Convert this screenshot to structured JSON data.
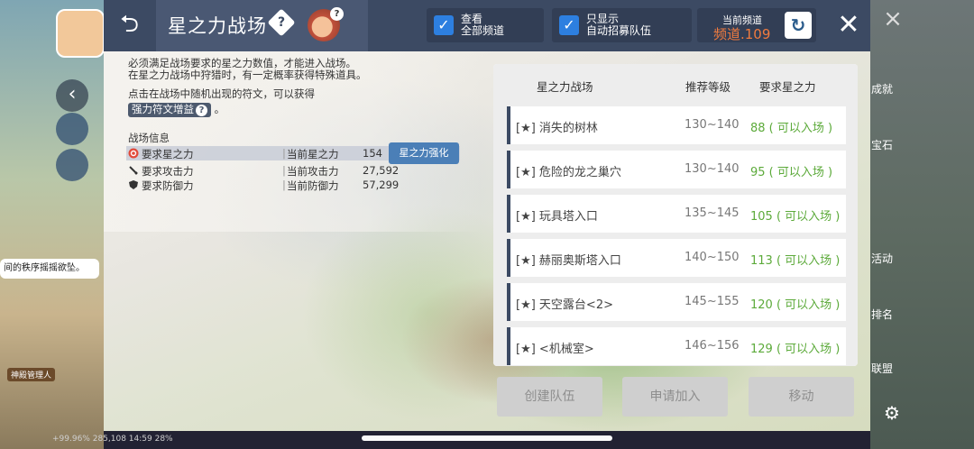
{
  "header": {
    "back_icon": "back-arrow-icon",
    "title": "星之力战场",
    "help_icon": "diamond-help-icon",
    "char_badge": "?",
    "view_all_label": "查看\n全部频道",
    "show_only_label": "只显示\n自动招募队伍",
    "channel_label": "当前频道",
    "channel_value": "频道.109",
    "refresh_icon": "refresh-icon",
    "close_icon": "close-icon"
  },
  "info": {
    "line1": "必须满足战场要求的星之力数值，才能进入战场。",
    "line2": "在星之力战场中狩猎时，有一定概率获得特殊道具。",
    "line3": "点击在战场中随机出现的符文，可以获得",
    "boost_tag": "强力符文增益",
    "boost_q": "?",
    "boost_suffix": " 。"
  },
  "stats": {
    "section_title": "战场信息",
    "rows": [
      {
        "icon": "star-force-icon",
        "name": "要求星之力",
        "sep": "|",
        "current_label": "当前星之力",
        "current_value": "154"
      },
      {
        "icon": "sword-icon",
        "name": "要求攻击力",
        "sep": "|",
        "current_label": "当前攻击力",
        "current_value": "27,592"
      },
      {
        "icon": "shield-icon",
        "name": "要求防御力",
        "sep": "|",
        "current_label": "当前防御力",
        "current_value": "57,299"
      }
    ],
    "boost_button": "星之力强化"
  },
  "list": {
    "headers": [
      "星之力战场",
      "推荐等级",
      "要求星之力"
    ],
    "rows": [
      {
        "name": "[★] 消失的树林",
        "level": "130~140",
        "req": "88 ( 可以入场 )"
      },
      {
        "name": "[★] 危险的龙之巢穴",
        "level": "130~140",
        "req": "95 ( 可以入场 )"
      },
      {
        "name": "[★] 玩具塔入口",
        "level": "135~145",
        "req": "105 ( 可以入场 )"
      },
      {
        "name": "[★] 赫丽奥斯塔入口",
        "level": "140~150",
        "req": "113 ( 可以入场 )"
      },
      {
        "name": "[★] 天空露台<2>",
        "level": "145~155",
        "req": "120 ( 可以入场 )"
      },
      {
        "name": "[★] <机械室>",
        "level": "146~156",
        "req": "129 ( 可以入场 )"
      }
    ]
  },
  "actions": {
    "create_party": "创建队伍",
    "apply_join": "申请加入",
    "move": "移动"
  },
  "background": {
    "speech": "间的秩序摇摇欲坠。",
    "npc_label": "神殿管理人",
    "side_labels": [
      "成就",
      "宝石",
      "活动",
      "排名",
      "联盟"
    ],
    "bottom_text": "+99.96%  285,108  14:59  28%"
  }
}
